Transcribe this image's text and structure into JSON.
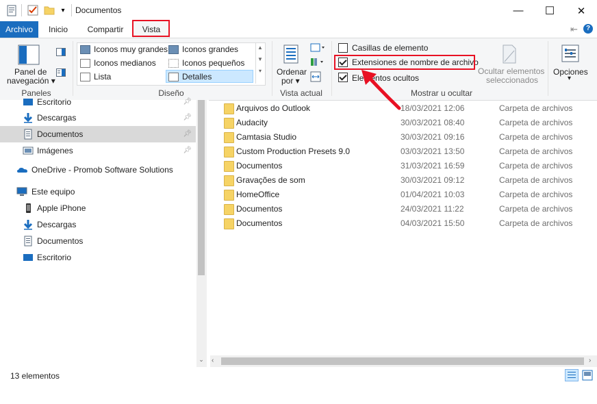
{
  "window": {
    "title": "Documentos",
    "controls": {
      "minimize": "—",
      "maximize": "☐",
      "close": "✕"
    }
  },
  "tabs": [
    "Archivo",
    "Inicio",
    "Compartir",
    "Vista"
  ],
  "ribbon": {
    "paneles": {
      "nav_pane_line1": "Panel de",
      "nav_pane_line2": "navegación ▾",
      "group": "Paneles"
    },
    "diseno": {
      "items": [
        "Iconos muy grandes",
        "Iconos grandes",
        "Iconos medianos",
        "Iconos pequeños",
        "Lista",
        "Detalles"
      ],
      "group": "Diseño"
    },
    "vista_actual": {
      "sort_line1": "Ordenar",
      "sort_line2": "por ▾",
      "group": "Vista actual"
    },
    "mostrar": {
      "checkboxes": [
        {
          "label": "Casillas de elemento",
          "checked": false
        },
        {
          "label": "Extensiones de nombre de archivo",
          "checked": true
        },
        {
          "label": "Elementos ocultos",
          "checked": true
        }
      ],
      "hide_line1": "Ocultar elementos",
      "hide_line2": "seleccionados",
      "group": "Mostrar u ocultar"
    },
    "opciones": {
      "label": "Opciones",
      "arrow": "▾"
    }
  },
  "nav": {
    "items": [
      {
        "label": "Escritorio",
        "pinned": true
      },
      {
        "label": "Descargas",
        "pinned": true
      },
      {
        "label": "Documentos",
        "pinned": true,
        "selected": true
      },
      {
        "label": "Imágenes",
        "pinned": true
      },
      {
        "label": "OneDrive - Promob Software Solutions"
      },
      {
        "label": "Este equipo"
      },
      {
        "label": "Apple iPhone"
      },
      {
        "label": "Descargas"
      },
      {
        "label": "Documentos"
      },
      {
        "label": "Escritorio"
      }
    ]
  },
  "files": [
    {
      "name": "Arquivos do Outlook",
      "date": "18/03/2021 12:06",
      "type": "Carpeta de archivos"
    },
    {
      "name": "Audacity",
      "date": "30/03/2021 08:40",
      "type": "Carpeta de archivos"
    },
    {
      "name": "Camtasia Studio",
      "date": "30/03/2021 09:16",
      "type": "Carpeta de archivos"
    },
    {
      "name": "Custom Production Presets 9.0",
      "date": "03/03/2021 13:50",
      "type": "Carpeta de archivos"
    },
    {
      "name": "Documentos",
      "date": "31/03/2021 16:59",
      "type": "Carpeta de archivos"
    },
    {
      "name": "Gravações de som",
      "date": "30/03/2021 09:12",
      "type": "Carpeta de archivos"
    },
    {
      "name": "HomeOffice",
      "date": "01/04/2021 10:03",
      "type": "Carpeta de archivos"
    },
    {
      "name": "Documentos",
      "date": "24/03/2021 11:22",
      "type": "Carpeta de archivos"
    },
    {
      "name": "Documentos",
      "date": "04/03/2021 15:50",
      "type": "Carpeta de archivos"
    }
  ],
  "status": {
    "count": "13 elementos"
  },
  "colors": {
    "accent": "#1a6dbf",
    "highlight": "#e81123",
    "selected_row": "#d9d9d9"
  }
}
